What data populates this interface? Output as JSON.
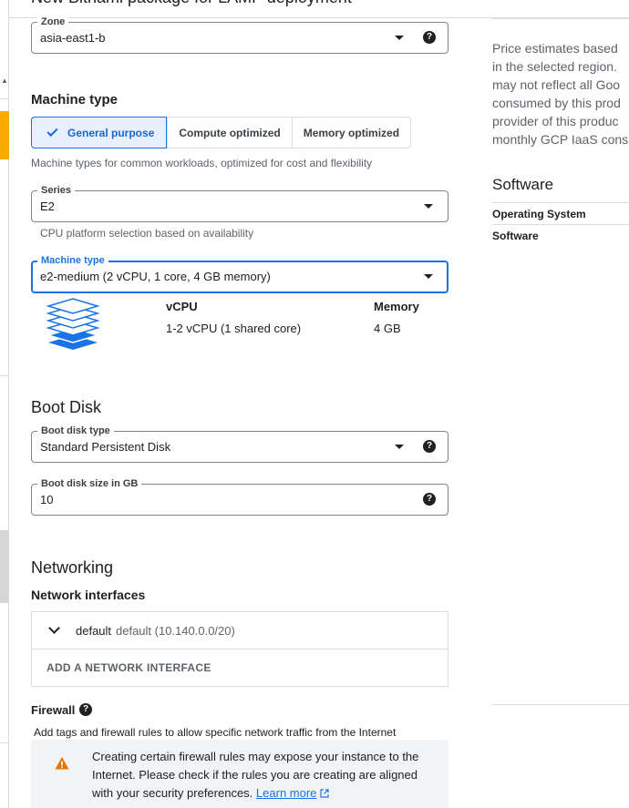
{
  "header": {
    "title": "New Bitnami package for LAMP deployment"
  },
  "zone": {
    "label": "Zone",
    "value": "asia-east1-b"
  },
  "machine_section": {
    "title": "Machine type",
    "tabs": [
      "General purpose",
      "Compute optimized",
      "Memory optimized"
    ],
    "selected_tab": "General purpose",
    "description": "Machine types for common workloads, optimized for cost and flexibility"
  },
  "series": {
    "label": "Series",
    "value": "E2",
    "hint": "CPU platform selection based on availability"
  },
  "machine_type": {
    "label": "Machine type",
    "value": "e2-medium (2 vCPU, 1 core, 4 GB memory)",
    "vcpu_header": "vCPU",
    "vcpu_value": "1-2 vCPU (1 shared core)",
    "memory_header": "Memory",
    "memory_value": "4 GB"
  },
  "boot_disk": {
    "title": "Boot Disk",
    "type_label": "Boot disk type",
    "type_value": "Standard Persistent Disk",
    "size_label": "Boot disk size in GB",
    "size_value": "10"
  },
  "networking": {
    "title": "Networking",
    "interfaces_title": "Network interfaces",
    "interface_name": "default",
    "interface_detail": "default (10.140.0.0/20)",
    "add_label": "ADD A NETWORK INTERFACE"
  },
  "firewall": {
    "title": "Firewall",
    "description": "Add tags and firewall rules to allow specific network traffic from the Internet",
    "warning_text": "Creating certain firewall rules may expose your instance to the Internet. Please check if the rules you are creating are aligned with your security preferences.",
    "learn_more": "Learn more"
  },
  "sidebar": {
    "price_lines": [
      "Price estimates based",
      "in the selected region.",
      "may not reflect all Goo",
      "consumed by this prod",
      "provider of this produc",
      "monthly GCP IaaS cons"
    ],
    "software_title": "Software",
    "software_rows": [
      "Operating System",
      "Software"
    ]
  },
  "help_glyph": "?",
  "colors": {
    "accent": "#1a73e8",
    "warning": "#e37400",
    "left_accent": "#f9ab00"
  }
}
